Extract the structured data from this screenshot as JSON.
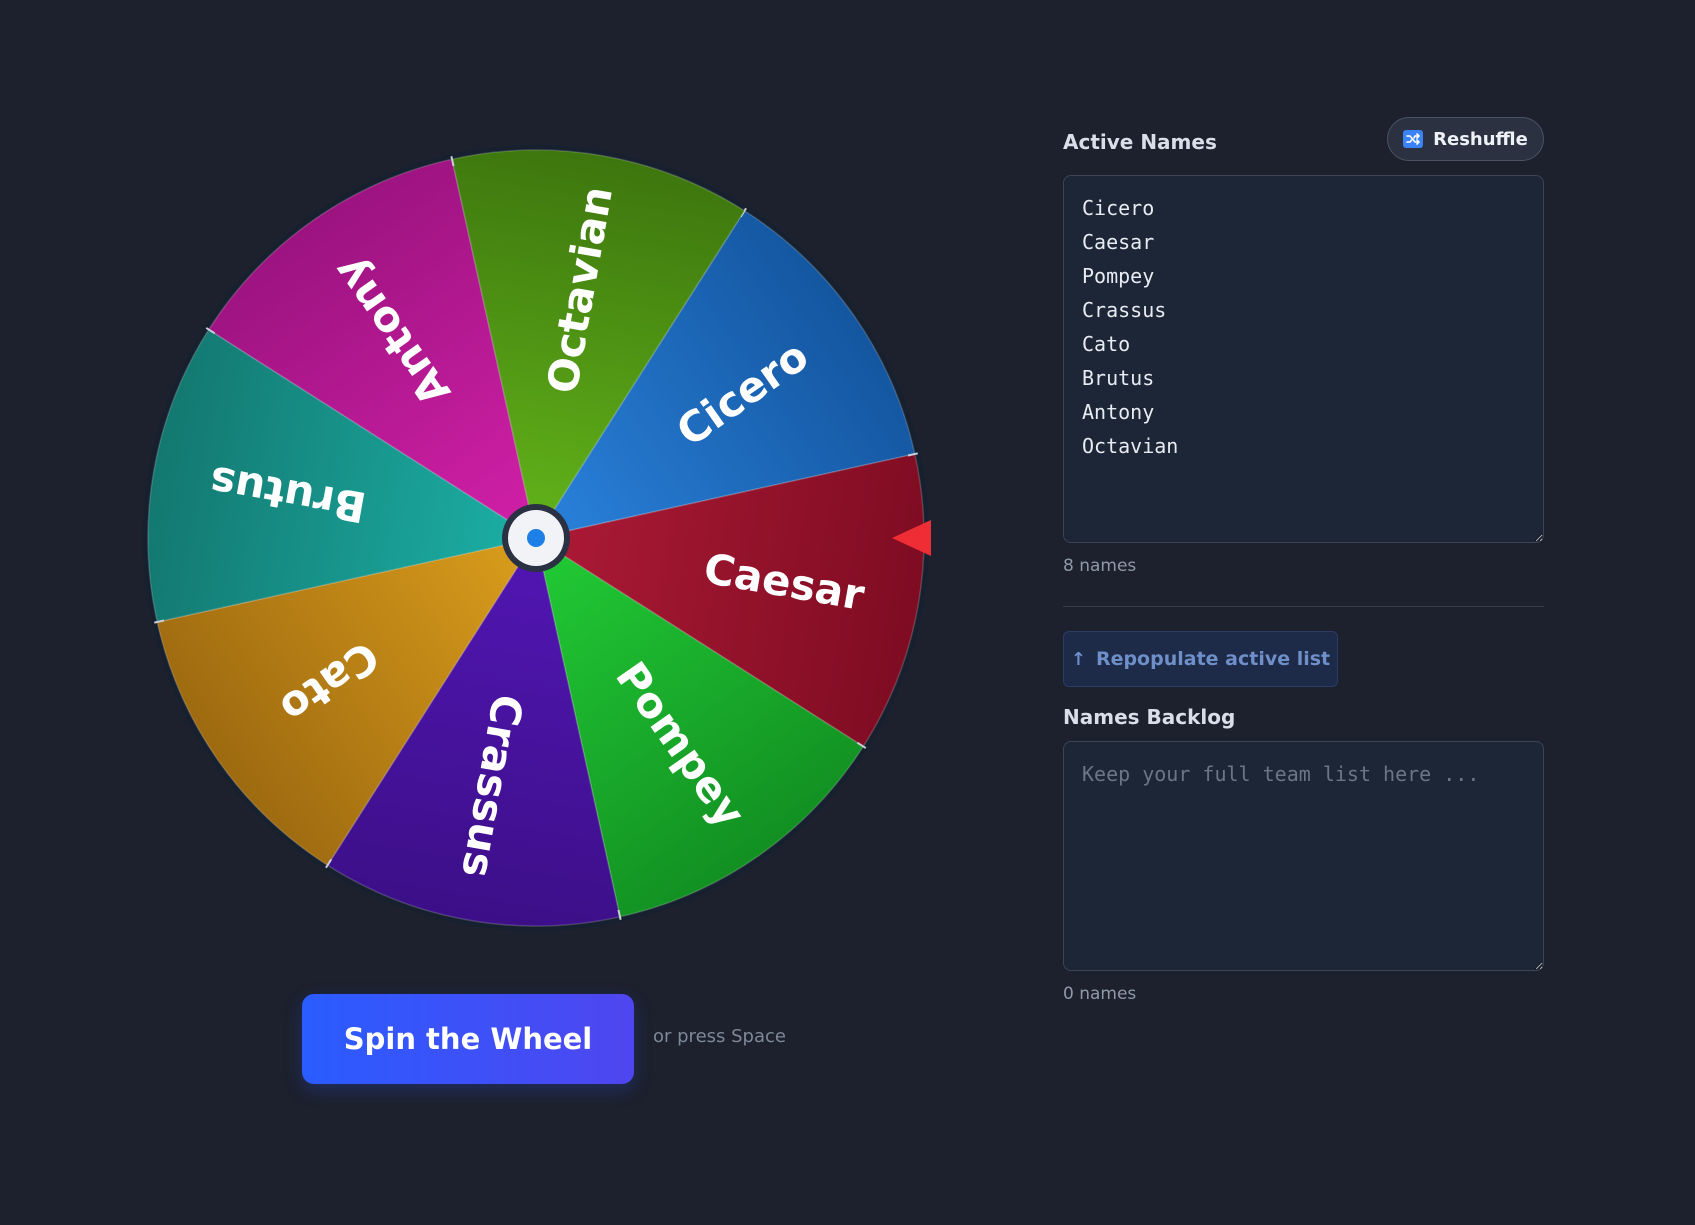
{
  "wheel": {
    "segments": [
      {
        "label": "Cicero",
        "color_light": "#2a82dc",
        "color_dark": "#1456a0"
      },
      {
        "label": "Caesar",
        "color_light": "#ad1a36",
        "color_dark": "#7e0c22"
      },
      {
        "label": "Pompey",
        "color_light": "#22cc36",
        "color_dark": "#129022"
      },
      {
        "label": "Crassus",
        "color_light": "#5216b4",
        "color_dark": "#3c0f88"
      },
      {
        "label": "Cato",
        "color_light": "#db9e1c",
        "color_dark": "#9e6a10"
      },
      {
        "label": "Brutus",
        "color_light": "#1cb0a6",
        "color_dark": "#137870"
      },
      {
        "label": "Antony",
        "color_light": "#d220a8",
        "color_dark": "#9c1380"
      },
      {
        "label": "Octavian",
        "color_light": "#62b41a",
        "color_dark": "#3d760e"
      }
    ],
    "pointer_color": "#ef2d35",
    "hub_dot_color": "#1e7fe6"
  },
  "spin": {
    "button_label": "Spin the Wheel",
    "hint": "or press Space"
  },
  "active": {
    "title": "Active Names",
    "reshuffle_label": "Reshuffle",
    "names_text": "Cicero\nCaesar\nPompey\nCrassus\nCato\nBrutus\nAntony\nOctavian",
    "count_label": "8 names"
  },
  "repopulate": {
    "label": "Repopulate active list",
    "icon": "arrow-up-icon"
  },
  "backlog": {
    "title": "Names Backlog",
    "placeholder": "Keep your full team list here ...",
    "value": "",
    "count_label": "0 names"
  }
}
